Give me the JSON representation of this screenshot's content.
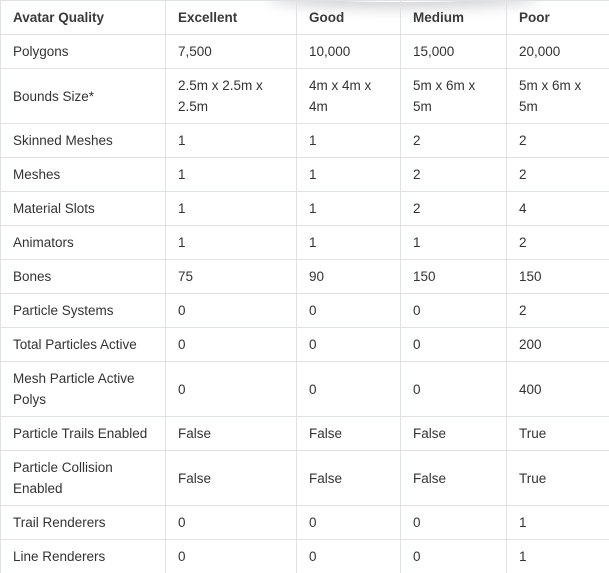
{
  "table": {
    "headers": [
      "Avatar Quality",
      "Excellent",
      "Good",
      "Medium",
      "Poor"
    ],
    "rows": [
      {
        "cells": [
          "Polygons",
          "7,500",
          "10,000",
          "15,000",
          "20,000"
        ],
        "tall": false
      },
      {
        "cells": [
          "Bounds Size*",
          "2.5m x 2.5m x 2.5m",
          "4m x 4m x 4m",
          "5m x 6m x 5m",
          "5m x 6m x 5m"
        ],
        "tall": true
      },
      {
        "cells": [
          "Skinned Meshes",
          "1",
          "1",
          "2",
          "2"
        ],
        "tall": false
      },
      {
        "cells": [
          "Meshes",
          "1",
          "1",
          "2",
          "2"
        ],
        "tall": false
      },
      {
        "cells": [
          "Material Slots",
          "1",
          "1",
          "2",
          "4"
        ],
        "tall": false
      },
      {
        "cells": [
          "Animators",
          "1",
          "1",
          "1",
          "2"
        ],
        "tall": false
      },
      {
        "cells": [
          "Bones",
          "75",
          "90",
          "150",
          "150"
        ],
        "tall": false
      },
      {
        "cells": [
          "Particle Systems",
          "0",
          "0",
          "0",
          "2"
        ],
        "tall": false
      },
      {
        "cells": [
          "Total Particles Active",
          "0",
          "0",
          "0",
          "200"
        ],
        "tall": false
      },
      {
        "cells": [
          "Mesh Particle Active Polys",
          "0",
          "0",
          "0",
          "400"
        ],
        "tall": true
      },
      {
        "cells": [
          "Particle Trails Enabled",
          "False",
          "False",
          "False",
          "True"
        ],
        "tall": false
      },
      {
        "cells": [
          "Particle Collision Enabled",
          "False",
          "False",
          "False",
          "True"
        ],
        "tall": true
      },
      {
        "cells": [
          "Trail Renderers",
          "0",
          "0",
          "0",
          "1"
        ],
        "tall": false
      },
      {
        "cells": [
          "Line Renderers",
          "0",
          "0",
          "0",
          "1"
        ],
        "tall": false
      }
    ]
  }
}
